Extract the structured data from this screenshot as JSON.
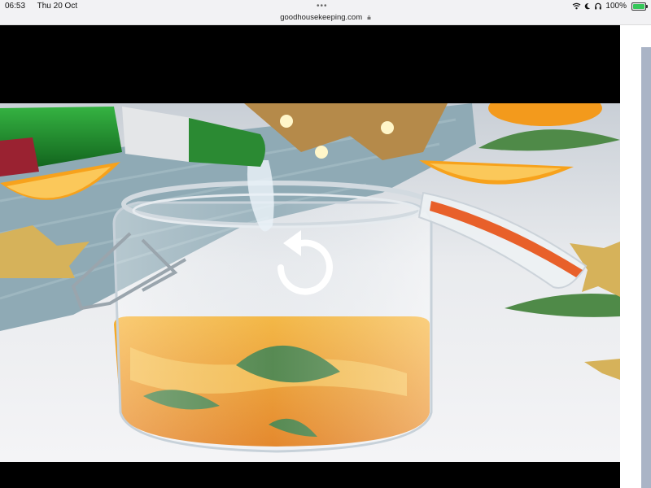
{
  "status_bar": {
    "time": "06:53",
    "date": "Thu 20 Oct",
    "battery_percent": "100%",
    "battery_level": 1.0,
    "icons": [
      "wifi-icon",
      "do-not-disturb-moon-icon",
      "headphones-icon",
      "battery-charging-icon"
    ]
  },
  "browser": {
    "url": "goodhousekeeping.com",
    "lock_icon": "lock-icon",
    "more_icon": "more-dots-icon"
  },
  "video": {
    "replay_icon": "replay-icon",
    "colors": {
      "liquid": "#f29a12",
      "bottle_green": "#1f8a2c",
      "lid_seal": "#e8602a",
      "orange": "#f7a21c"
    }
  }
}
